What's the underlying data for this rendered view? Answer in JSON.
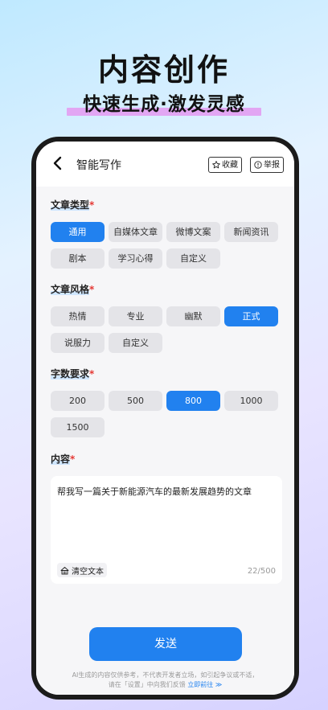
{
  "hero": {
    "title": "内容创作",
    "subtitle": "快速生成·激发灵感"
  },
  "topbar": {
    "title": "智能写作",
    "favorite_label": "收藏",
    "report_label": "举报"
  },
  "sections": {
    "type": {
      "label": "文章类型",
      "required": "*",
      "options": [
        "通用",
        "自媒体文章",
        "微博文案",
        "新闻资讯",
        "剧本",
        "学习心得",
        "自定义"
      ],
      "selected": "通用"
    },
    "style": {
      "label": "文章风格",
      "required": "*",
      "options": [
        "热情",
        "专业",
        "幽默",
        "正式",
        "说服力",
        "自定义"
      ],
      "selected": "正式"
    },
    "length": {
      "label": "字数要求",
      "required": "*",
      "options": [
        "200",
        "500",
        "800",
        "1000",
        "1500"
      ],
      "selected": "800"
    },
    "content": {
      "label": "内容",
      "required": "*",
      "value": "帮我写一篇关于新能源汽车的最新发展趋势的文章",
      "clear_label": "清空文本",
      "counter": "22/500"
    }
  },
  "send_label": "发送",
  "disclaimer": {
    "line1": "AI生成的内容仅供参考，不代表开发者立场，如引起争议或不适，",
    "line2": "请在「设置」中向我们反馈",
    "link": "立即前往 ≫"
  },
  "colors": {
    "accent": "#2181ef",
    "required": "#e53935",
    "chip_bg": "#e4e4e8"
  }
}
